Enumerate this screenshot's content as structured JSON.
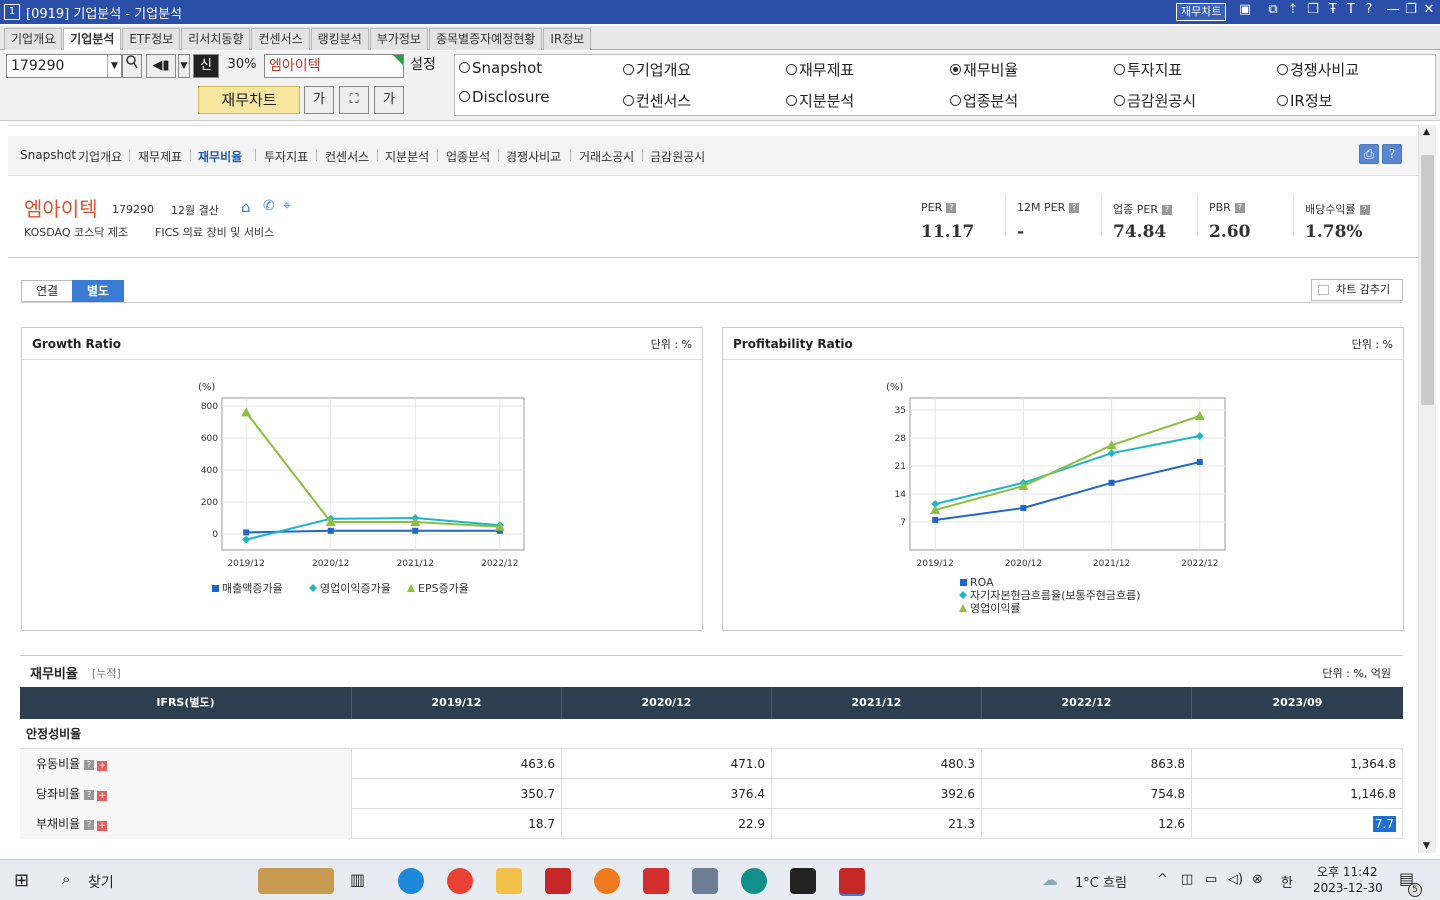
{
  "window": {
    "num": "1",
    "title": "[0919] 기업분석 - 기업분석",
    "fin_chart_btn": "재무차트"
  },
  "tabs": [
    "기업개요",
    "기업분석",
    "ETF정보",
    "리서치동향",
    "컨센서스",
    "랭킹분석",
    "부가정보",
    "종목별증자예정현황",
    "IR정보"
  ],
  "toolbar": {
    "code": "179290",
    "sin_label": "신",
    "pct": "30%",
    "name": "엠아이텍",
    "settings": "설정",
    "fin_chart": "재무차트",
    "font_btn": "가"
  },
  "radios": [
    {
      "label": "Snapshot",
      "selected": false
    },
    {
      "label": "기업개요",
      "selected": false
    },
    {
      "label": "재무제표",
      "selected": false
    },
    {
      "label": "재무비율",
      "selected": true
    },
    {
      "label": "투자지표",
      "selected": false
    },
    {
      "label": "경쟁사비교",
      "selected": false
    },
    {
      "label": "Disclosure",
      "selected": false
    },
    {
      "label": "컨센서스",
      "selected": false
    },
    {
      "label": "지분분석",
      "selected": false
    },
    {
      "label": "업종분석",
      "selected": false
    },
    {
      "label": "금감원공시",
      "selected": false
    },
    {
      "label": "IR정보",
      "selected": false
    }
  ],
  "subnav": [
    "Snapshot",
    "기업개요",
    "재무제표",
    "재무비율",
    "투자지표",
    "컨센서스",
    "지분분석",
    "업종분석",
    "경쟁사비교",
    "거래소공시",
    "금감원공시"
  ],
  "company": {
    "name": "엠아이텍",
    "code": "179290",
    "fiscal": "12월 결산",
    "market": "KOSDAQ  코스닥 제조",
    "fics": "FICS 의료 장비 및 서비스"
  },
  "metrics": [
    {
      "label": "PER",
      "value": "11.17"
    },
    {
      "label": "12M PER",
      "value": "-"
    },
    {
      "label": "업종 PER",
      "value": "74.84"
    },
    {
      "label": "PBR",
      "value": "2.60"
    },
    {
      "label": "배당수익률",
      "value": "1.78%"
    }
  ],
  "toggle": {
    "consolidated": "연결",
    "separate": "별도"
  },
  "hide_chart": "차트 감추기",
  "growth_panel": {
    "title": "Growth Ratio",
    "unit": "단위 : %",
    "ylabel": "(%)"
  },
  "profit_panel": {
    "title": "Profitability Ratio",
    "unit": "단위 : %",
    "ylabel": "(%)"
  },
  "chart_data": [
    {
      "type": "line",
      "title": "Growth Ratio",
      "ylabel": "(%)",
      "categories": [
        "2019/12",
        "2020/12",
        "2021/12",
        "2022/12"
      ],
      "yticks": [
        0,
        200,
        400,
        600,
        800
      ],
      "ylim": [
        -100,
        850
      ],
      "series": [
        {
          "name": "매출액증가율",
          "color": "#2266cc",
          "values": [
            10,
            20,
            20,
            20
          ]
        },
        {
          "name": "영업이익증가율",
          "color": "#1fb5c9",
          "values": [
            -35,
            95,
            100,
            55
          ]
        },
        {
          "name": "EPS증가율",
          "color": "#8cbf3f",
          "values": [
            760,
            75,
            75,
            45
          ]
        }
      ]
    },
    {
      "type": "line",
      "title": "Profitability Ratio",
      "ylabel": "(%)",
      "categories": [
        "2019/12",
        "2020/12",
        "2021/12",
        "2022/12"
      ],
      "yticks": [
        7,
        14,
        21,
        28,
        35
      ],
      "ylim": [
        0,
        38
      ],
      "series": [
        {
          "name": "ROA",
          "color": "#2266cc",
          "values": [
            7.5,
            10.5,
            16.8,
            22.0
          ]
        },
        {
          "name": "자기자본현금흐름율(보통주현금흐름)",
          "color": "#1fb5c9",
          "values": [
            11.5,
            16.8,
            24.2,
            28.5
          ]
        },
        {
          "name": "영업이익률",
          "color": "#8cbf3f",
          "values": [
            10.0,
            16.0,
            26.2,
            33.5
          ]
        }
      ]
    }
  ],
  "ratio_section": {
    "title": "재무비율",
    "sub": "[누적]",
    "unit": "단위 : %, 억원"
  },
  "table": {
    "header": [
      "IFRS(별도)",
      "2019/12",
      "2020/12",
      "2021/12",
      "2022/12",
      "2023/09"
    ],
    "group": "안정성비율",
    "rows": [
      {
        "label": "유동비율",
        "values": [
          "463.6",
          "471.0",
          "480.3",
          "863.8",
          "1,364.8"
        ]
      },
      {
        "label": "당좌비율",
        "values": [
          "350.7",
          "376.4",
          "392.6",
          "754.8",
          "1,146.8"
        ]
      },
      {
        "label": "부채비율",
        "values": [
          "18.7",
          "22.9",
          "21.3",
          "12.6",
          "7.7"
        ]
      }
    ]
  },
  "taskbar": {
    "search": "찾기",
    "weather": "1°C  흐림",
    "ime": "한",
    "time": "오후 11:42",
    "date": "2023-12-30",
    "notif": "5"
  }
}
